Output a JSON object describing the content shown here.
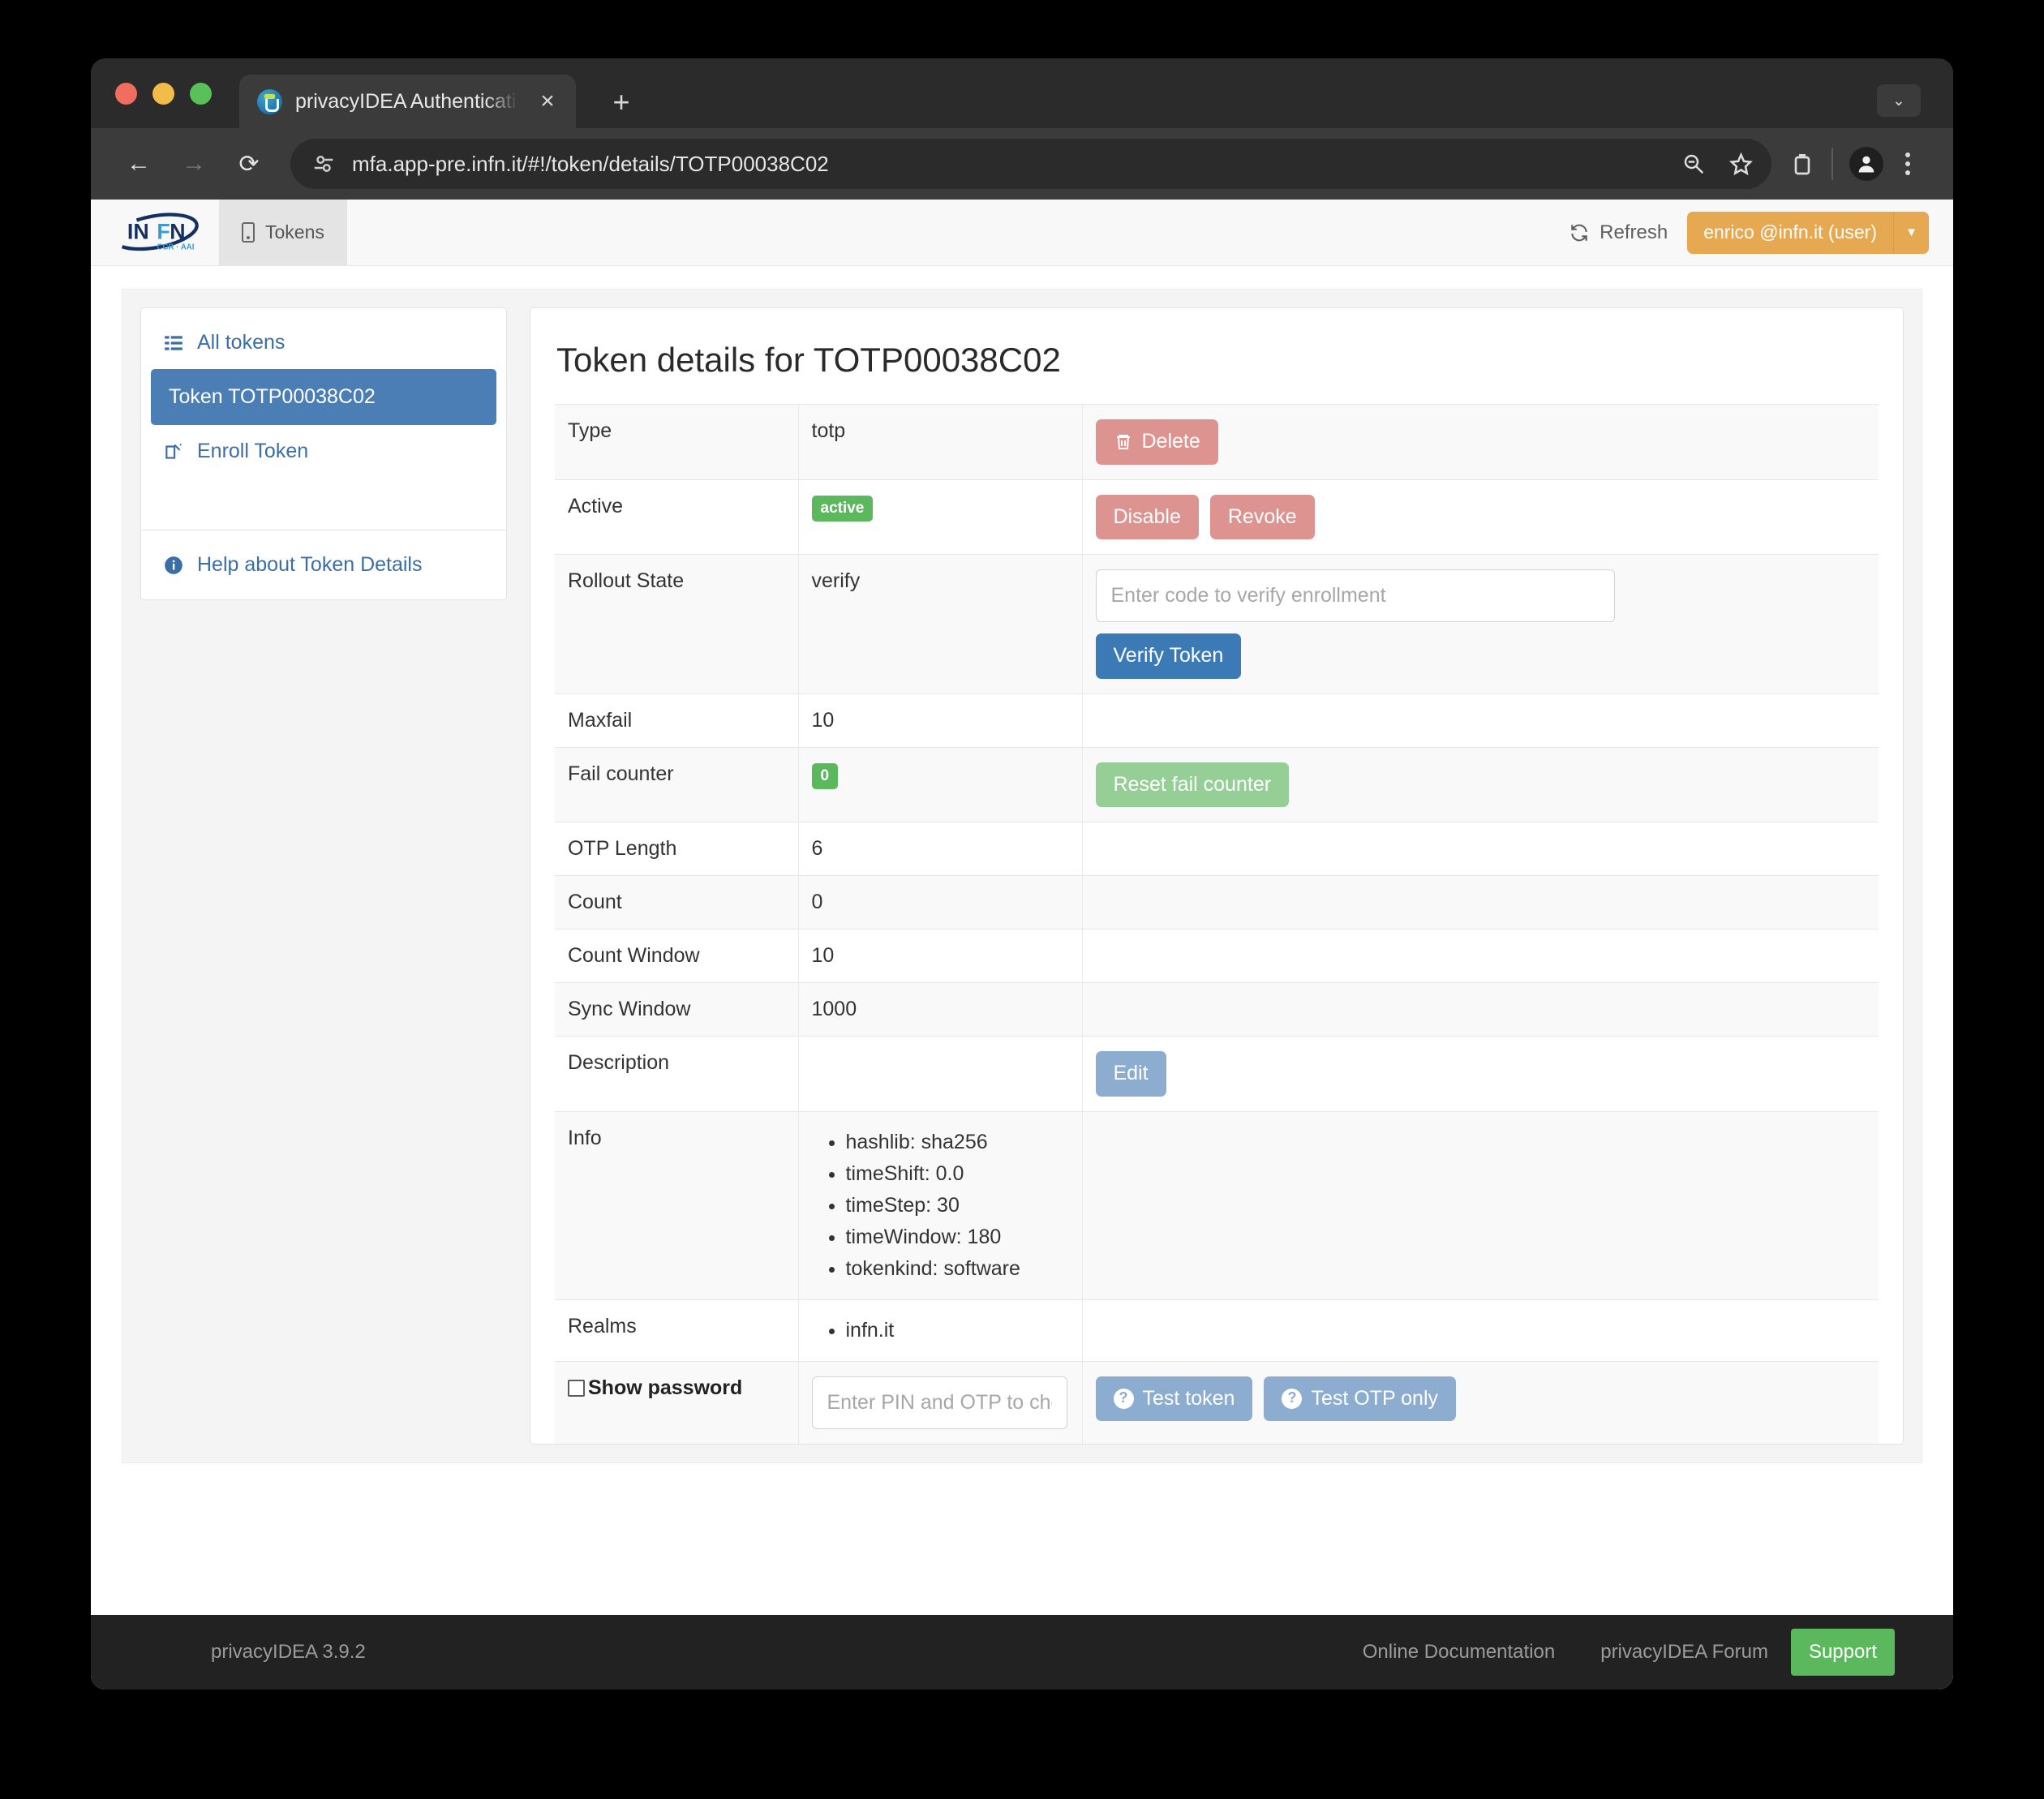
{
  "browser": {
    "tab": {
      "title": "privacyIDEA Authentication S",
      "favicon": "privacyidea-favicon",
      "close_label": "×"
    },
    "new_tab_label": "+",
    "window_chevron": "⌄",
    "nav": {
      "back": "←",
      "forward": "→",
      "reload": "⟳"
    },
    "url": "mfa.app-pre.infn.it/#!/token/details/TOTP00038C02",
    "omnibox_icons": [
      "site-settings-icon",
      "zoom-out-icon",
      "bookmark-star-icon",
      "extensions-icon",
      "profile-icon",
      "menu-icon"
    ]
  },
  "appbar": {
    "brand": {
      "name": "INFN",
      "subtitle": "CCR · AAI"
    },
    "tab_label": "Tokens",
    "refresh_label": "Refresh",
    "user_label": "enrico @infn.it (user)",
    "user_caret": "▼"
  },
  "sidebar": {
    "items": [
      {
        "label": "All tokens",
        "icon": "list-icon",
        "active": false
      },
      {
        "label": "Token TOTP00038C02",
        "icon": "none",
        "active": true
      },
      {
        "label": "Enroll Token",
        "icon": "edit-icon",
        "active": false
      }
    ],
    "help": {
      "label": "Help about Token Details",
      "icon": "info-icon"
    }
  },
  "main": {
    "title": "Token details for TOTP00038C02",
    "rows": {
      "type": {
        "key": "Type",
        "value": "totp",
        "delete_label": "Delete"
      },
      "active": {
        "key": "Active",
        "badge": "active",
        "disable_label": "Disable",
        "revoke_label": "Revoke"
      },
      "rollout": {
        "key": "Rollout State",
        "value": "verify",
        "placeholder": "Enter code to verify enrollment",
        "verify_label": "Verify Token"
      },
      "maxfail": {
        "key": "Maxfail",
        "value": "10"
      },
      "failcounter": {
        "key": "Fail counter",
        "badge": "0",
        "reset_label": "Reset fail counter"
      },
      "otplength": {
        "key": "OTP Length",
        "value": "6"
      },
      "count": {
        "key": "Count",
        "value": "0"
      },
      "countwindow": {
        "key": "Count Window",
        "value": "10"
      },
      "syncwindow": {
        "key": "Sync Window",
        "value": "1000"
      },
      "description": {
        "key": "Description",
        "value": "",
        "edit_label": "Edit"
      },
      "info": {
        "key": "Info",
        "items": [
          "hashlib: sha256",
          "timeShift: 0.0",
          "timeStep: 30",
          "timeWindow: 180",
          "tokenkind: software"
        ]
      },
      "realms": {
        "key": "Realms",
        "items": [
          "infn.it"
        ]
      },
      "test": {
        "show_password_label": "Show password",
        "placeholder": "Enter PIN and OTP to check the token",
        "test_token_label": "Test token",
        "test_otp_label": "Test OTP only"
      }
    }
  },
  "footer": {
    "version": "privacyIDEA 3.9.2",
    "links": [
      "Online Documentation",
      "privacyIDEA Forum"
    ],
    "support_label": "Support"
  },
  "colors": {
    "accent_blue": "#3c7ab5",
    "sidebar_active": "#4a7eb5",
    "danger": "#dd9491",
    "success": "#5cb85c",
    "success_soft": "#96cf96",
    "user_orange": "#e6a951",
    "light_blue": "#8cadd0"
  }
}
